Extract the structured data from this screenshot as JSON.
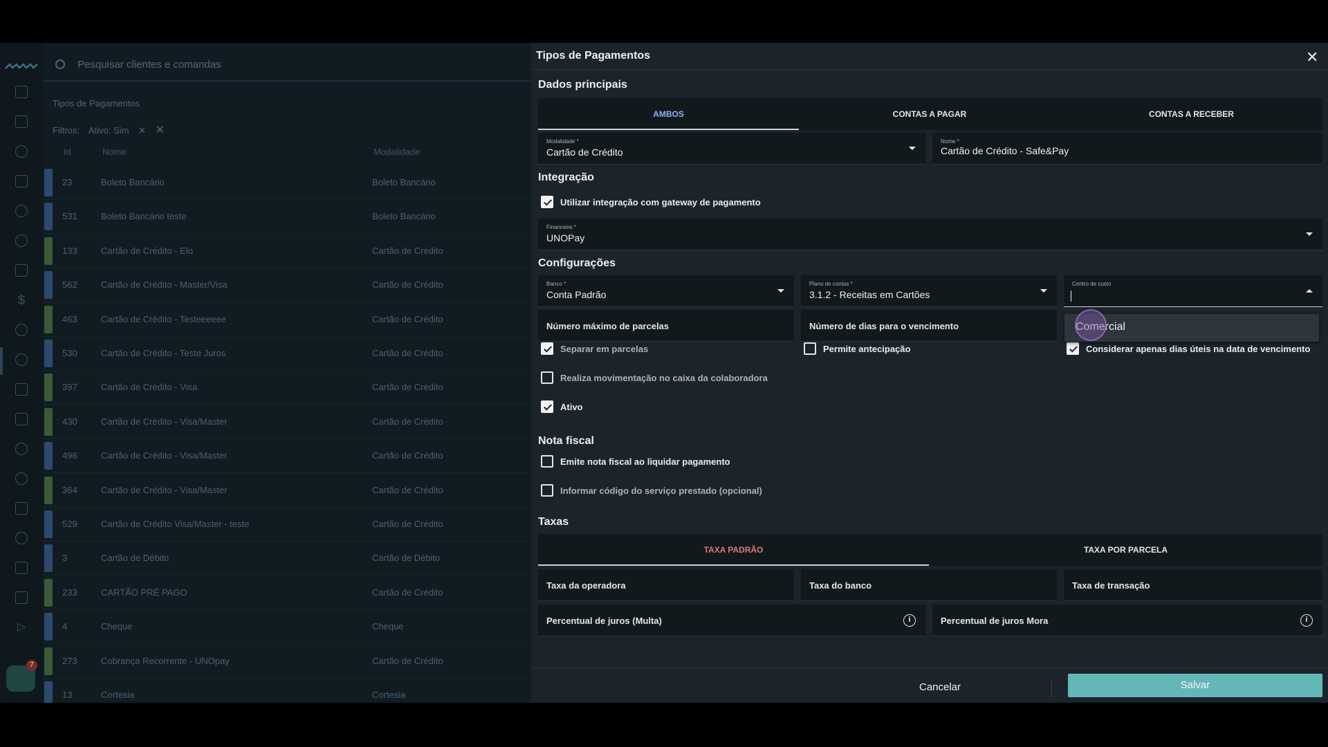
{
  "search": {
    "placeholder": "Pesquisar clientes e comandas"
  },
  "list": {
    "breadcrumb": "Tipos de Pagamentos",
    "filters_label": "Filtros:",
    "filter_chip": "Ativo: Sim",
    "columns": [
      "Id",
      "Nome",
      "Modalidade"
    ],
    "rows": [
      {
        "id": "23",
        "nome": "Boleto Bancário",
        "modalidade": "Boleto Bancário",
        "color": "#2c4a6e"
      },
      {
        "id": "531",
        "nome": "Boleto Bancário teste",
        "modalidade": "Boleto Bancário",
        "color": "#2c4a6e"
      },
      {
        "id": "133",
        "nome": "Cartão de Crédito - Elo",
        "modalidade": "Cartão de Crédito",
        "color": "#3c5a38"
      },
      {
        "id": "562",
        "nome": "Cartão de Crédito - Master/Visa",
        "modalidade": "Cartão de Crédito",
        "color": "#2c4a6e"
      },
      {
        "id": "463",
        "nome": "Cartão de Crédito - Testeeeeee",
        "modalidade": "Cartão de Crédito",
        "color": "#3c5a38"
      },
      {
        "id": "530",
        "nome": "Cartão de Crédito - Teste Juros",
        "modalidade": "Cartão de Crédito",
        "color": "#2c4a6e"
      },
      {
        "id": "397",
        "nome": "Cartão de Crédito - Visa",
        "modalidade": "Cartão de Crédito",
        "color": "#3c5a38"
      },
      {
        "id": "430",
        "nome": "Cartão de Crédito - Visa/Master",
        "modalidade": "Cartão de Crédito",
        "color": "#3c5a38"
      },
      {
        "id": "496",
        "nome": "Cartão de Crédito - Visa/Master",
        "modalidade": "Cartão de Crédito",
        "color": "#2c4a6e"
      },
      {
        "id": "364",
        "nome": "Cartão de Crédito - Visa/Master",
        "modalidade": "Cartão de Crédito",
        "color": "#3c5a38"
      },
      {
        "id": "529",
        "nome": "Cartão de Crédito Visa/Master - teste",
        "modalidade": "Cartão de Crédito",
        "color": "#2c4a6e"
      },
      {
        "id": "3",
        "nome": "Cartão de Débito",
        "modalidade": "Cartão de Débito",
        "color": "#2c4a6e"
      },
      {
        "id": "233",
        "nome": "CARTÃO PRÉ PAGO",
        "modalidade": "Cartão de Crédito",
        "color": "#3c5a38"
      },
      {
        "id": "4",
        "nome": "Cheque",
        "modalidade": "Cheque",
        "color": "#2c4a6e"
      },
      {
        "id": "273",
        "nome": "Cobrança Recorrente - UNOpay",
        "modalidade": "Cartão de Crédito",
        "color": "#3c5a38"
      },
      {
        "id": "13",
        "nome": "Cortesia",
        "modalidade": "Cortesia",
        "color": "#2c4a6e"
      }
    ]
  },
  "chat_badge": "7",
  "dialog": {
    "title": "Tipos de Pagamentos",
    "close": "✕",
    "sections": {
      "main": "Dados principais",
      "integration": "Integração",
      "config": "Configurações",
      "invoice": "Nota fiscal",
      "fees": "Taxas"
    },
    "tabs": [
      "AMBOS",
      "CONTAS A PAGAR",
      "CONTAS A RECEBER"
    ],
    "modalidade": {
      "label": "Modalidade *",
      "value": "Cartão de Crédito"
    },
    "nome": {
      "label": "Nome *",
      "value": "Cartão de Crédito - Safe&Pay"
    },
    "use_gateway": "Utilizar integração com gateway de pagamento",
    "financeira": {
      "label": "Financeira *",
      "value": "UNOPay"
    },
    "banco": {
      "label": "Banco *",
      "value": "Conta Padrão"
    },
    "plano": {
      "label": "Plano de contas *",
      "value": "3.1.2 - Receitas em Cartões"
    },
    "centro": {
      "label": "Centro de custo",
      "value": ""
    },
    "max_parcelas": "Número máximo de parcelas",
    "dias_vencimento": "Número de dias para o vencimento",
    "dropdown_option": "Comercial",
    "separar": "Separar em parcelas",
    "antecipacao": "Permite antecipação",
    "dias_uteis": "Considerar apenas dias úteis na data de vencimento",
    "movimentacao": "Realiza movimentação no caixa da colaboradora",
    "ativo": "Ativo",
    "emite_nota": "Emite nota fiscal ao liquidar pagamento",
    "codigo_servico": "Informar código do serviço prestado (opcional)",
    "fee_tabs": [
      "TAXA PADRÃO",
      "TAXA POR PARCELA"
    ],
    "taxa_operadora": "Taxa da operadora",
    "taxa_banco": "Taxa do banco",
    "taxa_transacao": "Taxa de transação",
    "juros_multa": "Percentual de juros (Multa)",
    "juros_mora": "Percentual de juros Mora",
    "cancel": "Cancelar",
    "save": "Salvar"
  },
  "colors": {
    "accent_tab": "#8ab4f8",
    "fee_tab_active": "#e0767e",
    "save_button": "#63b7b7"
  }
}
